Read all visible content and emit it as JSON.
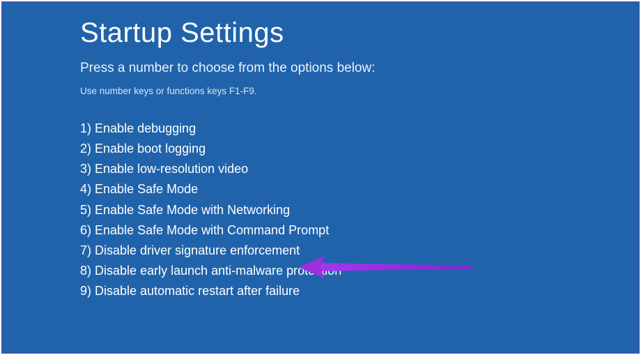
{
  "title": "Startup Settings",
  "subtitle": "Press a number to choose from the options below:",
  "hint": "Use number keys or functions keys F1-F9.",
  "options": [
    {
      "num": "1)",
      "label": "Enable debugging"
    },
    {
      "num": "2)",
      "label": "Enable boot logging"
    },
    {
      "num": "3)",
      "label": "Enable low-resolution video"
    },
    {
      "num": "4)",
      "label": "Enable Safe Mode"
    },
    {
      "num": "5)",
      "label": "Enable Safe Mode with Networking"
    },
    {
      "num": "6)",
      "label": "Enable Safe Mode with Command Prompt"
    },
    {
      "num": "7)",
      "label": "Disable driver signature enforcement"
    },
    {
      "num": "8)",
      "label": "Disable early launch anti-malware protection"
    },
    {
      "num": "9)",
      "label": "Disable automatic restart after failure"
    }
  ],
  "annotation": {
    "color": "#9b2fe0",
    "target_index": 6
  }
}
